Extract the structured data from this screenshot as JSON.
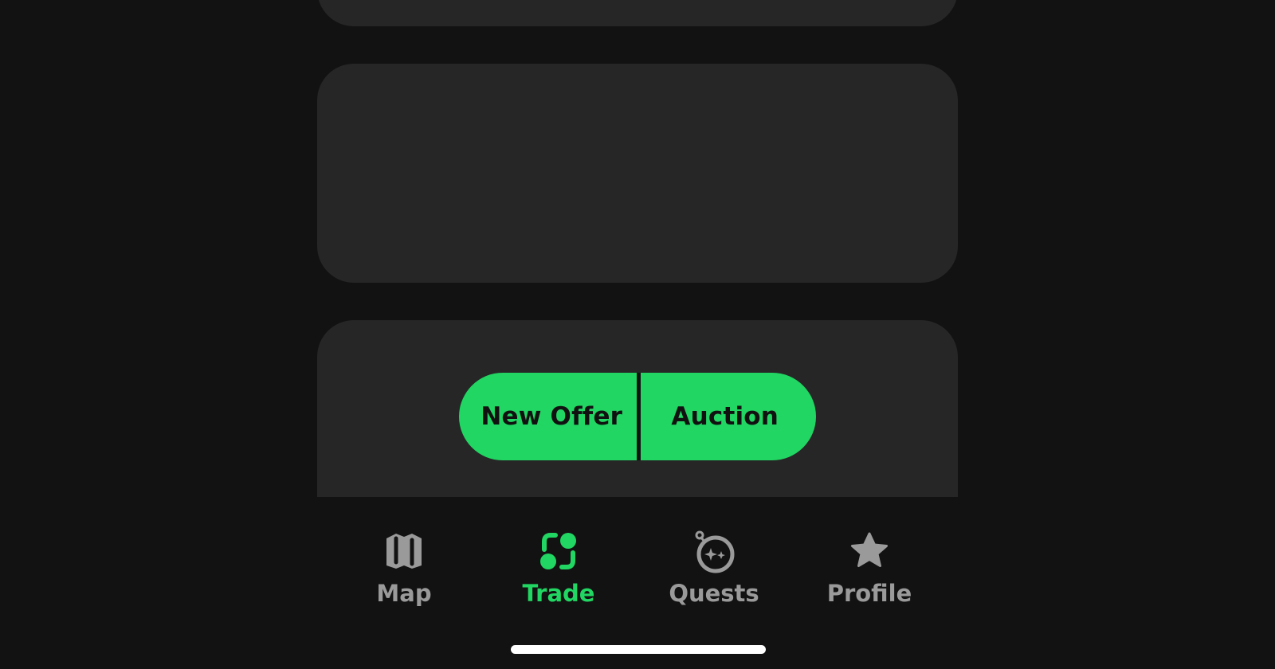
{
  "actions": {
    "new_offer_label": "New Offer",
    "auction_label": "Auction"
  },
  "tabbar": {
    "items": [
      {
        "label": "Map",
        "icon": "map-icon",
        "active": false
      },
      {
        "label": "Trade",
        "icon": "trade-icon",
        "active": true
      },
      {
        "label": "Quests",
        "icon": "quests-icon",
        "active": false
      },
      {
        "label": "Profile",
        "icon": "star-icon",
        "active": false
      }
    ]
  },
  "colors": {
    "background": "#121212",
    "card": "#262626",
    "accent": "#21d662",
    "inactive": "#9a9a9a",
    "home_indicator": "#ffffff"
  }
}
